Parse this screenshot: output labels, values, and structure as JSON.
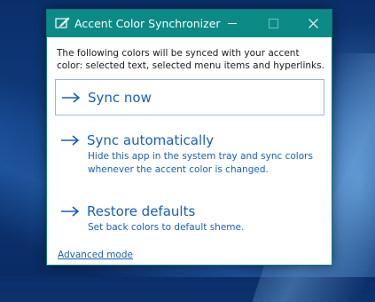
{
  "window": {
    "title": "Accent Color Synchronizer",
    "accent_color": "#0c8a86",
    "link_color": "#1a5fb4"
  },
  "description": "The following colors will be synced with your accent color: selected text, selected menu items and hyperlinks.",
  "actions": [
    {
      "icon": "arrow-right-icon",
      "label": "Sync now",
      "subtitle": ""
    },
    {
      "icon": "arrow-right-icon",
      "label": "Sync automatically",
      "subtitle": "Hide this app in the system tray and sync colors whenever the accent color is changed."
    },
    {
      "icon": "arrow-right-icon",
      "label": "Restore defaults",
      "subtitle": "Set back colors to default sheme."
    }
  ],
  "advanced_link": "Advanced mode",
  "title_bar_icons": [
    "app-icon",
    "minimize-icon",
    "maximize-icon",
    "close-icon"
  ]
}
